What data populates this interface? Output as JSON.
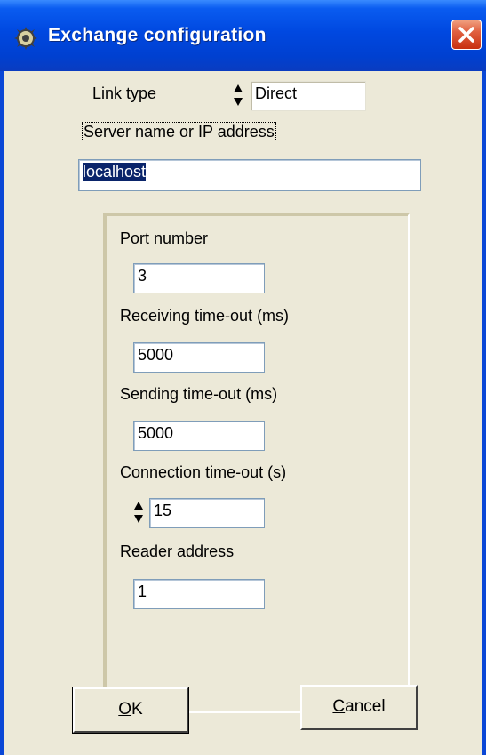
{
  "window": {
    "title": "Exchange configuration",
    "icon": "app-gear-icon",
    "close_icon": "close-icon",
    "colors": {
      "titlebar": "#0048e0",
      "client": "#ece9d8",
      "close": "#e06040"
    }
  },
  "link_type": {
    "label": "Link type",
    "value": "Direct"
  },
  "server": {
    "label": "Server name or IP address",
    "value": "localhost"
  },
  "group": {
    "port": {
      "label": "Port number",
      "value": "3"
    },
    "receiving_timeout": {
      "label": "Receiving time-out (ms)",
      "value": "5000"
    },
    "sending_timeout": {
      "label": "Sending time-out (ms)",
      "value": "5000"
    },
    "connection_timeout": {
      "label": "Connection time-out (s)",
      "value": "15"
    },
    "reader_address": {
      "label": "Reader address",
      "value": "1"
    }
  },
  "buttons": {
    "ok_mnemonic": "O",
    "ok_rest": "K",
    "cancel_mnemonic": "C",
    "cancel_rest": "ancel"
  }
}
